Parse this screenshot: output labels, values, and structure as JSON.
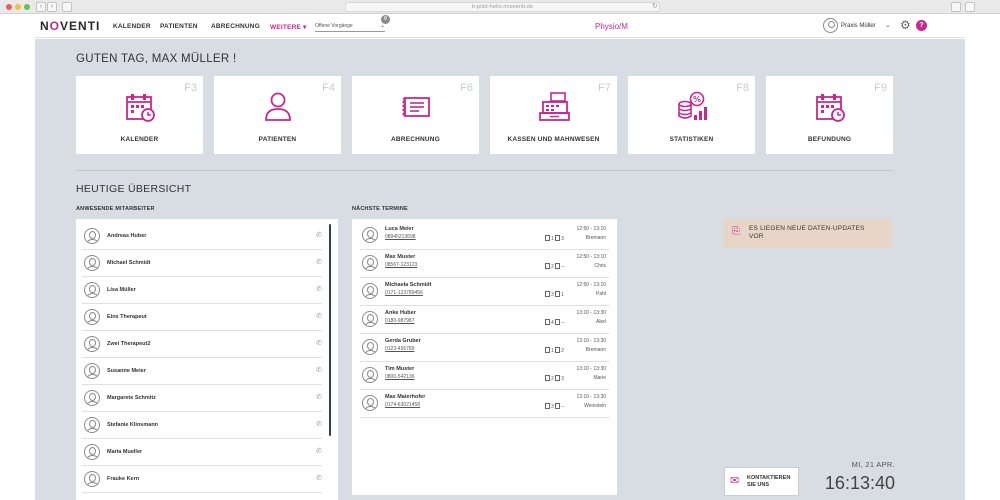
{
  "browser": {
    "url": "b-pilot-hello.nnoventi.de",
    "reload": "↻"
  },
  "header": {
    "logo_parts": [
      "N",
      "O",
      "VENTI"
    ],
    "nav": [
      "KALENDER",
      "PATIENTEN",
      "ABRECHNUNG",
      "WEITERE ▾"
    ],
    "select_value": "Offene Vorgänge",
    "select_badge": "0",
    "app_title": "Physio/M",
    "user": "Praxis Müller",
    "help": "?",
    "colors": {
      "brand": "#c8288c"
    }
  },
  "greeting": "GUTEN TAG, MAX MÜLLER !",
  "tiles": [
    {
      "label": "KALENDER",
      "fkey": "F3",
      "icon": "calendar-icon"
    },
    {
      "label": "PATIENTEN",
      "fkey": "F4",
      "icon": "person-icon"
    },
    {
      "label": "ABRECHNUNG",
      "fkey": "F6",
      "icon": "invoice-icon"
    },
    {
      "label": "KASSEN UND MAHNWESEN",
      "fkey": "F7",
      "icon": "cash-register-icon"
    },
    {
      "label": "STATISTIKEN",
      "fkey": "F8",
      "icon": "statistics-icon"
    },
    {
      "label": "BEFUNDUNG",
      "fkey": "F9",
      "icon": "calendar-icon"
    }
  ],
  "overview_title": "HEUTIGE ÜBERSICHT",
  "staff_title": "ANWESENDE MITARBEITER",
  "staff": [
    "Andreas Huber",
    "Michael Schmidt",
    "Lisa Müller",
    "Eins Therapeut",
    "Zwei Therapeut2",
    "Susanne Meier",
    "Margarete Schmitz",
    "Stefanie Klinsmann",
    "Maria Mueller",
    "Frauke Kern"
  ],
  "appointments_title": "NÄCHSTE TERMINE",
  "appointments": [
    {
      "name": "Luca Meier",
      "phone": "08945213698",
      "time": "12:50 - 13:10",
      "count": "1",
      "room": "3",
      "who": "Bremann"
    },
    {
      "name": "Max Muster",
      "phone": "08567-123123",
      "time": "12:50 - 13:10",
      "count": "2",
      "room": "--",
      "who": "Chris"
    },
    {
      "name": "Michaela Schmidt",
      "phone": "0171-123789456",
      "time": "12:50 - 13:10",
      "count": "3",
      "room": "1",
      "who": "Pahl"
    },
    {
      "name": "Anke Huber",
      "phone": "0180-987987",
      "time": "13:10 - 13:30",
      "count": "4",
      "room": "--",
      "who": "Abel"
    },
    {
      "name": "Gerda Gruber",
      "phone": "0123-456789",
      "time": "13:10 - 13:30",
      "count": "1",
      "room": "2",
      "who": "Bremann"
    },
    {
      "name": "Tim Muster",
      "phone": "0800-542136",
      "time": "13:10 - 13:30",
      "count": "2",
      "room": "3",
      "who": "Marie"
    },
    {
      "name": "Max Maierhofer",
      "phone": "0174-63021458",
      "time": "13:10 - 13:30",
      "count": "3",
      "room": "--",
      "who": "Weinstein"
    }
  ],
  "update_notice": "ES LIEGEN NEUE DATEN-UPDATES VOR",
  "contact": "KONTAKTIEREN SIE UNS",
  "date": "MI, 21 APR.",
  "time": "16:13:40"
}
